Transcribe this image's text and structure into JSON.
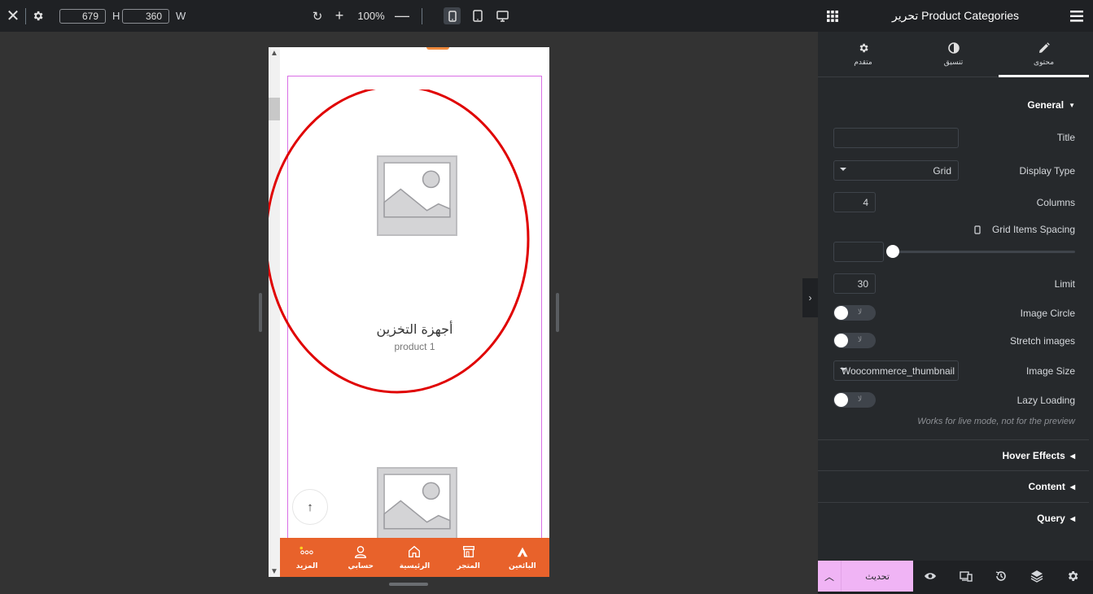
{
  "topbar": {
    "close_icon": "close-icon",
    "settings_icon": "gear-icon",
    "height_value": "679",
    "height_label": "H",
    "width_value": "360",
    "width_label": "W",
    "zoom_level": "100%",
    "active_device": "mobile"
  },
  "preview": {
    "categories": [
      {
        "name": "أجهزة التخزين",
        "count_label": "product 1"
      },
      {
        "name": "",
        "count_label": ""
      }
    ],
    "bottom_nav": [
      {
        "icon": "store-tent-icon",
        "label": "البائعين"
      },
      {
        "icon": "shop-icon",
        "label": "المتجر"
      },
      {
        "icon": "home-icon",
        "label": "الرئيسية"
      },
      {
        "icon": "user-icon",
        "label": "حسابي"
      },
      {
        "icon": "more-icon",
        "label": "المزيد"
      }
    ],
    "colors": {
      "nav_bg": "#e8622b",
      "widget_outline": "#d96ee6",
      "annotation": "#e00000"
    }
  },
  "panel": {
    "title": "تحرير Product Categories",
    "tabs": [
      {
        "label": "محتوى",
        "icon": "pencil-icon",
        "active": true
      },
      {
        "label": "تنسيق",
        "icon": "contrast-icon",
        "active": false
      },
      {
        "label": "متقدم",
        "icon": "gear-icon",
        "active": false
      }
    ],
    "general": {
      "section_title": "General",
      "title_label": "Title",
      "title_value": "",
      "display_type_label": "Display Type",
      "display_type_value": "Grid",
      "columns_label": "Columns",
      "columns_value": "4",
      "spacing_label": "Grid Items Spacing",
      "spacing_value": "",
      "limit_label": "Limit",
      "limit_value": "30",
      "image_circle_label": "Image Circle",
      "image_circle_value": "لا",
      "stretch_label": "Stretch images",
      "stretch_value": "لا",
      "image_size_label": "Image Size",
      "image_size_value": "Woocommerce_thumbnail",
      "lazy_label": "Lazy Loading",
      "lazy_value": "لا",
      "lazy_hint": "Works for live mode, not for the preview"
    },
    "sections": [
      {
        "title": "Hover Effects"
      },
      {
        "title": "Content"
      },
      {
        "title": "Query"
      }
    ],
    "footer": {
      "update_label": "تحديث",
      "accent": "#f0b4f5"
    }
  }
}
